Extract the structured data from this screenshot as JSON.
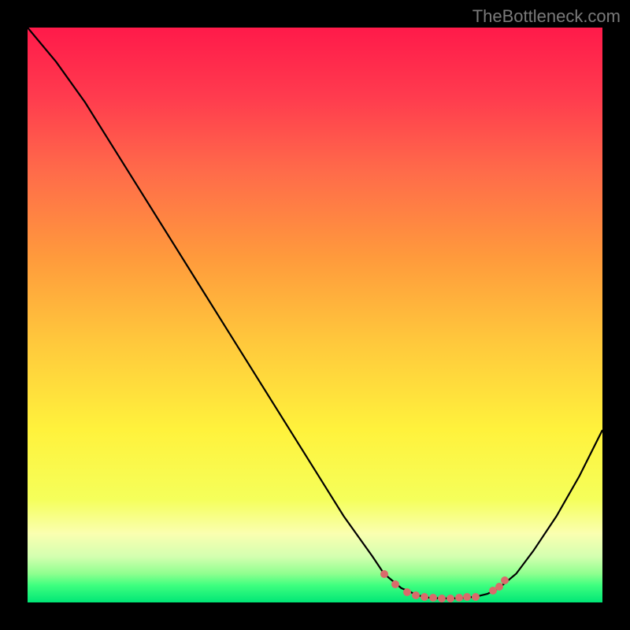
{
  "watermark": "TheBottleneck.com",
  "chart_data": {
    "type": "line",
    "title": "",
    "xlabel": "",
    "ylabel": "",
    "xlim": [
      0,
      100
    ],
    "ylim": [
      0,
      100
    ],
    "series": [
      {
        "name": "bottleneck-curve",
        "x": [
          0,
          5,
          10,
          15,
          20,
          25,
          30,
          35,
          40,
          45,
          50,
          55,
          60,
          62,
          65,
          68,
          70,
          72,
          74,
          76,
          78,
          80,
          82,
          85,
          88,
          92,
          96,
          100
        ],
        "y": [
          100,
          94,
          87,
          79,
          71,
          63,
          55,
          47,
          39,
          31,
          23,
          15,
          8,
          5,
          2.5,
          1.2,
          0.8,
          0.7,
          0.7,
          0.8,
          1.0,
          1.5,
          2.5,
          5,
          9,
          15,
          22,
          30
        ],
        "color": "#000000"
      }
    ],
    "markers": {
      "name": "optimal-range",
      "color": "#d96b6b",
      "points": [
        {
          "x": 62,
          "y": 5.0
        },
        {
          "x": 64,
          "y": 3.2
        },
        {
          "x": 66,
          "y": 1.8
        },
        {
          "x": 67.5,
          "y": 1.3
        },
        {
          "x": 69,
          "y": 1.0
        },
        {
          "x": 70.5,
          "y": 0.8
        },
        {
          "x": 72,
          "y": 0.7
        },
        {
          "x": 73.5,
          "y": 0.7
        },
        {
          "x": 75,
          "y": 0.8
        },
        {
          "x": 76.5,
          "y": 0.9
        },
        {
          "x": 78,
          "y": 1.0
        },
        {
          "x": 81,
          "y": 2.0
        },
        {
          "x": 82,
          "y": 2.8
        },
        {
          "x": 83,
          "y": 3.8
        }
      ]
    },
    "gradient_stops": [
      {
        "offset": 0,
        "color": "#ff1a4a"
      },
      {
        "offset": 12,
        "color": "#ff3b4e"
      },
      {
        "offset": 25,
        "color": "#ff6b4a"
      },
      {
        "offset": 40,
        "color": "#ff9a3c"
      },
      {
        "offset": 55,
        "color": "#ffc93c"
      },
      {
        "offset": 70,
        "color": "#fff23c"
      },
      {
        "offset": 82,
        "color": "#f5ff5a"
      },
      {
        "offset": 88,
        "color": "#faffb0"
      },
      {
        "offset": 92,
        "color": "#d4ffb0"
      },
      {
        "offset": 95,
        "color": "#8fff8f"
      },
      {
        "offset": 97,
        "color": "#3fff7f"
      },
      {
        "offset": 100,
        "color": "#00e676"
      }
    ]
  }
}
